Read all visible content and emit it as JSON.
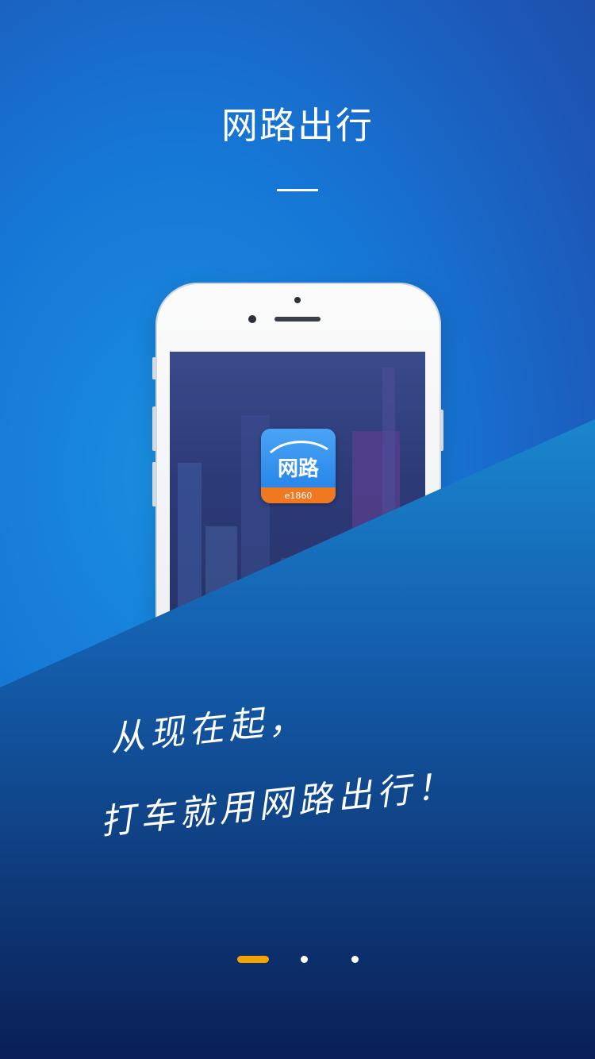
{
  "header": {
    "title": "网路出行"
  },
  "app_icon": {
    "label": "网路",
    "sub_label": "e1860"
  },
  "slogan": {
    "line1": "从现在起，",
    "line2": "打车就用网路出行！"
  },
  "pager": {
    "total": 3,
    "current": 1
  },
  "colors": {
    "accent": "#f5a300",
    "background": "#1677d6",
    "band_dark": "#0a2a66"
  },
  "icons": [
    "camera-icon",
    "app-logo-icon"
  ]
}
